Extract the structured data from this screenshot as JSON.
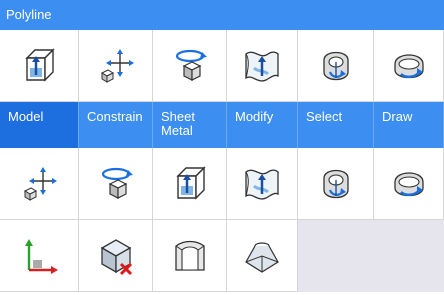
{
  "panel": {
    "title": "Polyline"
  },
  "tabs": [
    {
      "label": "Model"
    },
    {
      "label": "Constrain"
    },
    {
      "label": "Sheet Metal"
    },
    {
      "label": "Modify"
    },
    {
      "label": "Select"
    },
    {
      "label": "Draw"
    }
  ],
  "row1_icons": [
    "extrude-box-icon",
    "move-3d-icon",
    "rotate-3d-icon",
    "surface-icon",
    "revolve-icon",
    "rotate-arrow-icon"
  ],
  "row2_icons": [
    "move-3d-icon",
    "rotate-3d-icon",
    "extrude-box-icon",
    "surface-icon",
    "revolve-icon",
    "rotate-arrow-icon"
  ],
  "row3_icons": [
    "ucs-axis-icon",
    "delete-solid-icon",
    "shell-icon",
    "loft-icon"
  ],
  "colors": {
    "accent": "#3c8ff0",
    "active_tab": "#1d6fe0",
    "empty": "#e6e5ee"
  }
}
